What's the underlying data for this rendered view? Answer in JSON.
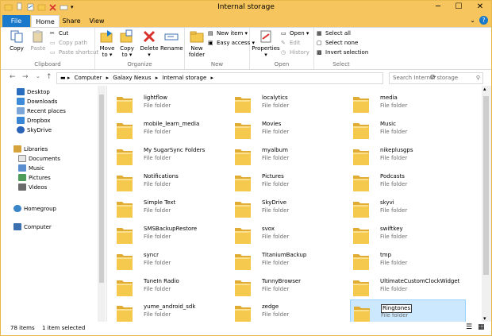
{
  "window": {
    "title": "Internal storage",
    "min": "─",
    "max": "☐",
    "close": "✕"
  },
  "tabs": [
    "File",
    "Home",
    "Share",
    "View"
  ],
  "ribbon": {
    "clipboard": {
      "copy": "Copy",
      "paste": "Paste",
      "cut": "Cut",
      "copy_path": "Copy path",
      "paste_shortcut": "Paste shortcut",
      "label": "Clipboard"
    },
    "organize": {
      "move_to": "Move",
      "move_to2": "to ▾",
      "copy_to": "Copy",
      "copy_to2": "to ▾",
      "delete": "Delete",
      "delete2": "▾",
      "rename": "Rename",
      "label": "Organize"
    },
    "new": {
      "new_folder": "New",
      "new_folder2": "folder",
      "new_item": "New item ▾",
      "easy_access": "Easy access ▾",
      "label": "New"
    },
    "open": {
      "properties": "Properties",
      "properties2": "▾",
      "open": "Open ▾",
      "edit": "Edit",
      "history": "History",
      "label": "Open"
    },
    "select": {
      "select_all": "Select all",
      "select_none": "Select none",
      "invert": "Invert selection",
      "label": "Select"
    }
  },
  "address": {
    "crumbs": [
      "Computer",
      "▸",
      "Galaxy Nexus",
      "▸",
      "Internal storage",
      "▸"
    ],
    "search_placeholder": "Search Internal storage"
  },
  "nav": {
    "favorites": [
      "Desktop",
      "Downloads",
      "Recent places",
      "Dropbox",
      "SkyDrive"
    ],
    "libraries": "Libraries",
    "library_items": [
      "Documents",
      "Music",
      "Pictures",
      "Videos"
    ],
    "homegroup": "Homegroup",
    "computer": "Computer"
  },
  "files": [
    {
      "name": "lightflow",
      "type": "File folder"
    },
    {
      "name": "localytics",
      "type": "File folder"
    },
    {
      "name": "media",
      "type": "File folder"
    },
    {
      "name": "mobile_learn_media",
      "type": "File folder"
    },
    {
      "name": "Movies",
      "type": "File folder"
    },
    {
      "name": "Music",
      "type": "File folder"
    },
    {
      "name": "My SugarSync Folders",
      "type": "File folder"
    },
    {
      "name": "myalbum",
      "type": "File folder"
    },
    {
      "name": "nikeplusgps",
      "type": "File folder"
    },
    {
      "name": "Notifications",
      "type": "File folder"
    },
    {
      "name": "Pictures",
      "type": "File folder"
    },
    {
      "name": "Podcasts",
      "type": "File folder"
    },
    {
      "name": "Simple Text",
      "type": "File folder"
    },
    {
      "name": "SkyDrive",
      "type": "File folder"
    },
    {
      "name": "skyvi",
      "type": "File folder"
    },
    {
      "name": "SMSBackupRestore",
      "type": "File folder"
    },
    {
      "name": "svox",
      "type": "File folder"
    },
    {
      "name": "swiftkey",
      "type": "File folder"
    },
    {
      "name": "syncr",
      "type": "File folder"
    },
    {
      "name": "TitaniumBackup",
      "type": "File folder"
    },
    {
      "name": "tmp",
      "type": "File folder"
    },
    {
      "name": "TuneIn Radio",
      "type": "File folder"
    },
    {
      "name": "TunnyBrowser",
      "type": "File folder"
    },
    {
      "name": "UltimateCustomClockWidget",
      "type": "File folder"
    },
    {
      "name": "yume_android_sdk",
      "type": "File folder"
    },
    {
      "name": "zedge",
      "type": "File folder"
    },
    {
      "name": "Ringtones",
      "type": "File folder",
      "selected": true,
      "renaming": true
    }
  ],
  "status": {
    "count": "78 items",
    "selected": "1 item selected"
  },
  "colors": {
    "titlebar": "#f7c55d",
    "file_tab": "#1979ca",
    "folder": "#f5c94e",
    "selection": "#cce8ff"
  }
}
